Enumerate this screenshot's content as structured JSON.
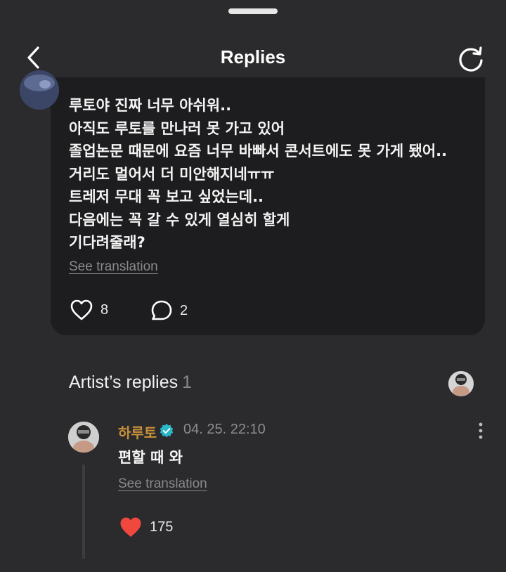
{
  "header": {
    "title": "Replies",
    "back_icon": "chevron-left-icon",
    "refresh_icon": "refresh-icon"
  },
  "post": {
    "lines": [
      "루토야 진짜 너무 아쉬워..",
      "아직도 루토를 만나러 못 가고 있어",
      "졸업논문 때문에 요즘 너무 바빠서 콘서트에도 못 가게 됐어..",
      "거리도 멀어서 더 미안해지네ㅠㅠ",
      "트레저 무대 꼭 보고 싶었는데..",
      "다음에는 꼭 갈 수 있게 열심히 할게",
      "기다려줄래?"
    ],
    "see_translation": "See translation",
    "like_count": "8",
    "comment_count": "2"
  },
  "artist_replies": {
    "title": "Artist’s replies",
    "count": "1"
  },
  "reply": {
    "author": "하루토",
    "time": "04. 25. 22:10",
    "text": "편할 때 와",
    "see_translation": "See translation",
    "like_count": "175"
  },
  "colors": {
    "background": "#2b2b2d",
    "card": "#1d1d1f",
    "author": "#c8913a",
    "verified": "#2bb5c8",
    "heart_filled": "#f0473f"
  }
}
